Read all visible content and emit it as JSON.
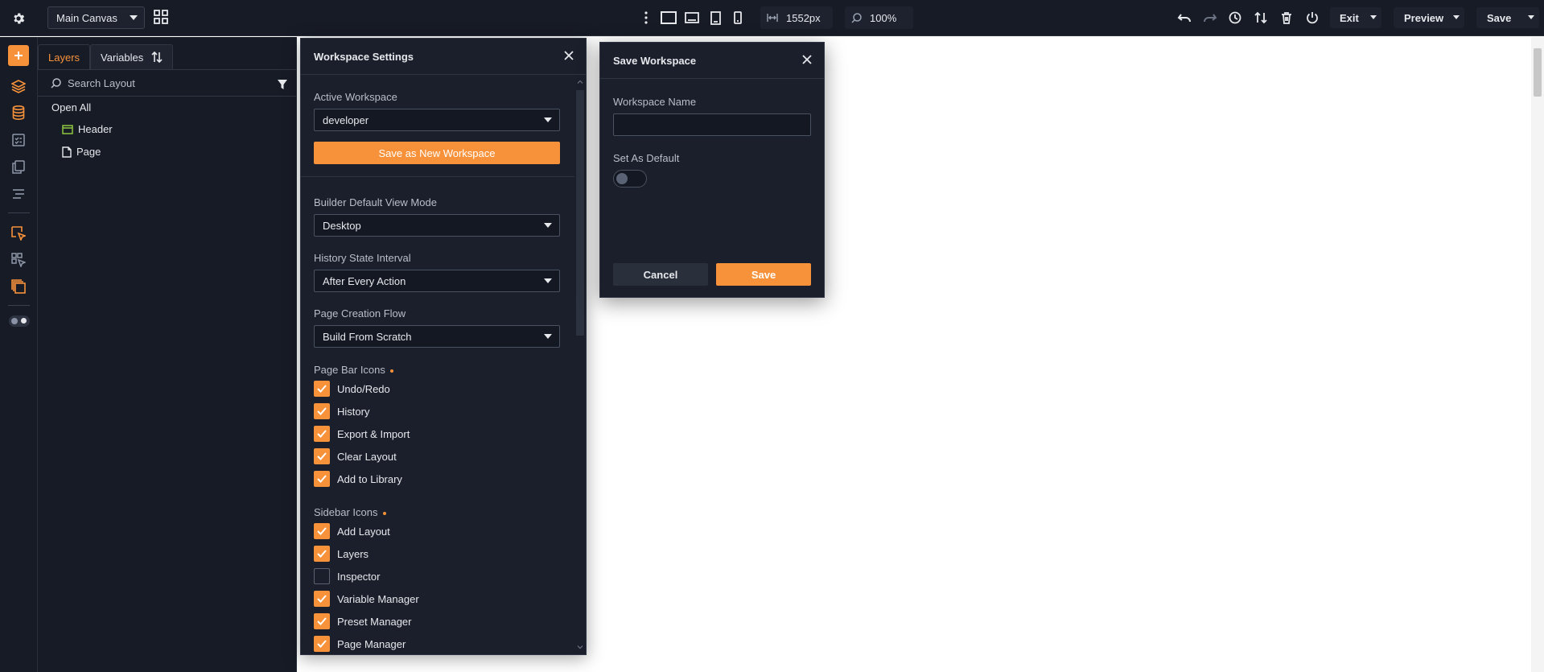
{
  "topbar": {
    "canvas_select": "Main Canvas",
    "width_value": "1552px",
    "zoom_value": "100%",
    "exit_label": "Exit",
    "preview_label": "Preview",
    "save_label": "Save"
  },
  "layers": {
    "tabs": [
      {
        "label": "Layers",
        "active": true
      },
      {
        "label": "Variables",
        "active": false
      }
    ],
    "search_placeholder": "Search Layout",
    "open_all": "Open All",
    "items": [
      {
        "label": "Header",
        "icon": "header-icon"
      },
      {
        "label": "Page",
        "icon": "page-icon"
      }
    ]
  },
  "workspace_settings": {
    "title": "Workspace Settings",
    "active_workspace_label": "Active Workspace",
    "active_workspace_value": "developer",
    "save_new_button": "Save as New Workspace",
    "view_mode_label": "Builder Default View Mode",
    "view_mode_value": "Desktop",
    "history_label": "History State Interval",
    "history_value": "After Every Action",
    "page_flow_label": "Page Creation Flow",
    "page_flow_value": "Build From Scratch",
    "page_bar_icons_label": "Page Bar Icons",
    "page_bar_icons": [
      {
        "label": "Undo/Redo",
        "checked": true
      },
      {
        "label": "History",
        "checked": true
      },
      {
        "label": "Export & Import",
        "checked": true
      },
      {
        "label": "Clear Layout",
        "checked": true
      },
      {
        "label": "Add to Library",
        "checked": true
      }
    ],
    "sidebar_icons_label": "Sidebar Icons",
    "sidebar_icons": [
      {
        "label": "Add Layout",
        "checked": true
      },
      {
        "label": "Layers",
        "checked": true
      },
      {
        "label": "Inspector",
        "checked": false
      },
      {
        "label": "Variable Manager",
        "checked": true
      },
      {
        "label": "Preset Manager",
        "checked": true
      },
      {
        "label": "Page Manager",
        "checked": true
      }
    ]
  },
  "save_workspace": {
    "title": "Save Workspace",
    "name_label": "Workspace Name",
    "name_value": "",
    "default_label": "Set As Default",
    "default_on": false,
    "cancel_label": "Cancel",
    "save_label": "Save"
  },
  "colors": {
    "accent": "#f7923a",
    "panel_bg": "#171b26",
    "modal_bg": "#1b1f2b",
    "canvas_bg": "#ffffff"
  }
}
